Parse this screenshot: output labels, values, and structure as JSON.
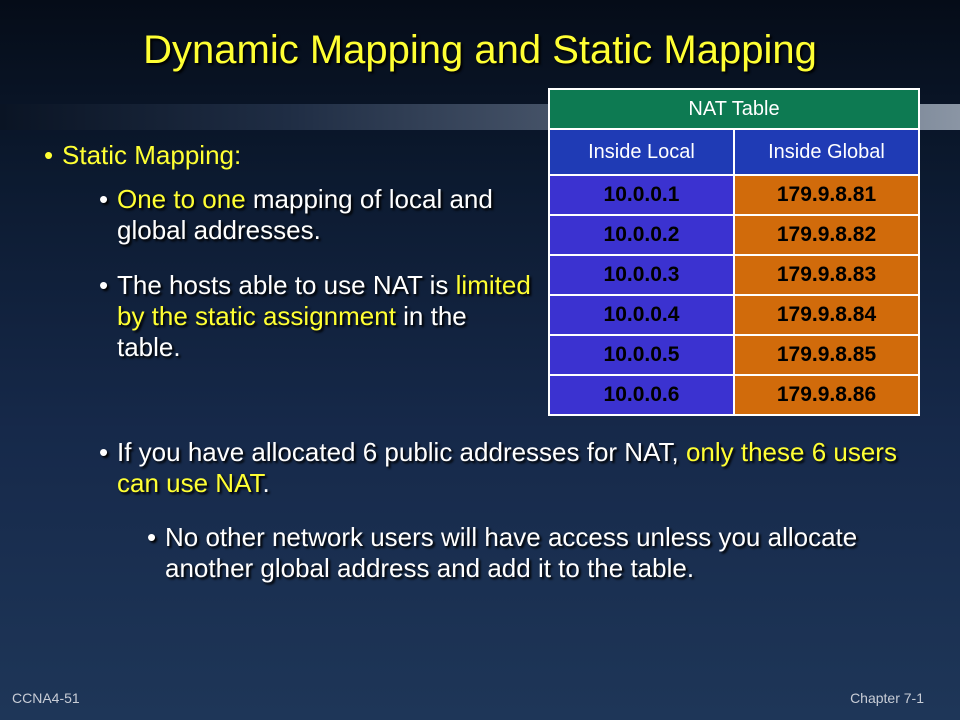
{
  "slide": {
    "title": "Dynamic Mapping and Static Mapping",
    "bullet_symbol": "•",
    "b1": {
      "text": "Static Mapping:"
    },
    "b2": {
      "yellow": "One to one",
      "rest": " mapping of local and global addresses."
    },
    "b3": {
      "white_start": "The hosts able to use NAT is ",
      "yellow": "limited by the static assignment",
      "rest": " in the table."
    },
    "b4": {
      "white_start": "If you have allocated 6 public addresses for NAT, ",
      "yellow": "only these 6 users can use NAT",
      "rest": "."
    },
    "b5": {
      "text": "No other network users will have access unless you allocate another global address and add it to the table."
    }
  },
  "nat_table": {
    "title": "NAT Table",
    "headers": [
      "Inside Local",
      "Inside Global"
    ],
    "rows": [
      [
        "10.0.0.1",
        "179.9.8.81"
      ],
      [
        "10.0.0.2",
        "179.9.8.82"
      ],
      [
        "10.0.0.3",
        "179.9.8.83"
      ],
      [
        "10.0.0.4",
        "179.9.8.84"
      ],
      [
        "10.0.0.5",
        "179.9.8.85"
      ],
      [
        "10.0.0.6",
        "179.9.8.86"
      ]
    ]
  },
  "footer": {
    "left": "CCNA4-51",
    "right": "Chapter 7-1"
  },
  "colors": {
    "title": "#ffff33",
    "highlight": "#ffff33",
    "table_title_bg": "#0d7a52",
    "table_header_bg": "#1f3bb5",
    "local_cell_bg": "#3b32d0",
    "global_cell_bg": "#d16b0b"
  }
}
